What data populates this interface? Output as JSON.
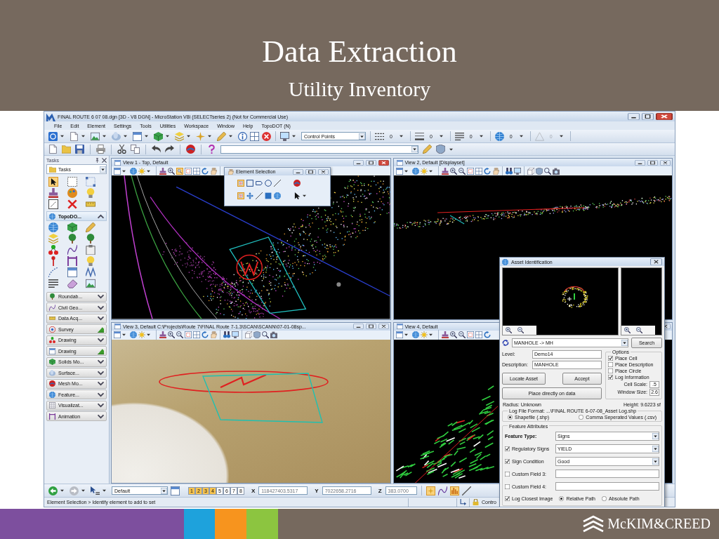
{
  "slide": {
    "title": "Data Extraction",
    "subtitle": "Utility Inventory",
    "logo": "McKIM&CREED"
  },
  "window": {
    "title": "FINAL ROUTE 6 07 08.dgn [3D - V8 DGN] - MicroStation V8i (SELECTseries 2) (Not for Commercial Use)",
    "menu": [
      "File",
      "Edit",
      "Element",
      "Settings",
      "Tools",
      "Utilities",
      "Workspace",
      "Window",
      "Help",
      "TopoDOT (N)"
    ]
  },
  "toolbar": {
    "dropdown": "Control Points",
    "counters": [
      {
        "value": "0",
        "disabled": false
      },
      {
        "value": "0",
        "disabled": false
      },
      {
        "value": "0",
        "disabled": false
      },
      {
        "value": "0",
        "disabled": false
      },
      {
        "value": "0",
        "disabled": true
      }
    ]
  },
  "tasks": {
    "title": "Tasks",
    "dropdown": "Tasks",
    "tools": [
      {
        "selected": true
      },
      {
        "selected": false
      },
      {
        "selected": false
      },
      {
        "selected": false
      },
      {
        "selected": false
      },
      {
        "selected": false
      },
      {
        "selected": false
      },
      {
        "selected": false
      },
      {
        "selected": false
      }
    ],
    "section": "TopoDO...",
    "groups": [
      {
        "label": "Roundab...",
        "kind": "collapsed"
      },
      {
        "label": "Civil Geo...",
        "kind": "collapsed"
      },
      {
        "label": "Data Acq...",
        "kind": "collapsed"
      },
      {
        "label": "Survey",
        "kind": "toolbox"
      },
      {
        "label": "Drawing",
        "kind": "collapsed"
      },
      {
        "label": "Drawing",
        "kind": "toolbox"
      },
      {
        "label": "Solids Mo...",
        "kind": "collapsed"
      },
      {
        "label": "Surface...",
        "kind": "collapsed"
      },
      {
        "label": "Mesh Mo...",
        "kind": "collapsed"
      },
      {
        "label": "Feature...",
        "kind": "collapsed"
      },
      {
        "label": "Visualizat...",
        "kind": "collapsed"
      },
      {
        "label": "Animation",
        "kind": "collapsed"
      }
    ]
  },
  "views": [
    {
      "title": "View 1 - Top, Default",
      "kind": "top",
      "active": true,
      "tools": [
        {
          "selected": false
        },
        {
          "selected": false
        },
        {
          "selected": false
        },
        {
          "selected": false
        },
        {
          "selected": false
        },
        {
          "selected": true
        },
        {
          "selected": false
        },
        {
          "selected": false
        },
        {
          "selected": false
        },
        {
          "selected": false
        }
      ]
    },
    {
      "title": "View 2, Default [Displayset]",
      "kind": "side",
      "active": false,
      "tools": [
        {
          "selected": false
        },
        {
          "selected": false
        },
        {
          "selected": false
        },
        {
          "selected": false
        },
        {
          "selected": false
        },
        {
          "selected": false
        },
        {
          "selected": false
        },
        {
          "selected": false
        },
        {
          "selected": false
        },
        {
          "selected": false
        },
        {
          "selected": false
        },
        {
          "selected": false
        },
        {
          "selected": false
        },
        {
          "selected": false
        },
        {
          "selected": false
        },
        {
          "selected": false
        }
      ]
    },
    {
      "title": "View 3, Default C:\\Projects\\Route 7\\FINAL Route 7-1.3\\SCAN\\SCANN\\07-01-08sp...",
      "kind": "photo",
      "active": false,
      "tools": [
        {
          "selected": false
        },
        {
          "selected": false
        },
        {
          "selected": false
        },
        {
          "selected": false
        },
        {
          "selected": false
        },
        {
          "selected": false
        },
        {
          "selected": false
        },
        {
          "selected": false
        },
        {
          "selected": false
        },
        {
          "selected": false
        },
        {
          "selected": false
        },
        {
          "selected": false
        },
        {
          "selected": false
        },
        {
          "selected": false
        },
        {
          "selected": false
        },
        {
          "selected": false
        }
      ]
    },
    {
      "title": "View 4, Default",
      "kind": "iso",
      "active": false,
      "tools": [
        {
          "selected": false
        },
        {
          "selected": false
        },
        {
          "selected": false
        },
        {
          "selected": false
        },
        {
          "selected": false
        },
        {
          "selected": false
        },
        {
          "selected": false
        },
        {
          "selected": false
        },
        {
          "selected": false
        }
      ]
    }
  ],
  "element_selection": {
    "title": "Element Selection",
    "tools": [
      {
        "selected": true
      },
      {
        "selected": false
      },
      {
        "selected": false
      },
      {
        "selected": false
      },
      {
        "selected": false
      },
      {
        "selected": false
      },
      {
        "selected": true
      },
      {
        "selected": false
      },
      {
        "selected": false
      },
      {
        "selected": false
      },
      {
        "selected": false
      },
      {
        "selected": false
      }
    ]
  },
  "bottom_toolbar": {
    "level": "Default",
    "view_buttons": [
      {
        "label": "1",
        "on": true
      },
      {
        "label": "2",
        "on": true
      },
      {
        "label": "3",
        "on": true
      },
      {
        "label": "4",
        "on": true
      },
      {
        "label": "5",
        "on": false
      },
      {
        "label": "6",
        "on": false
      },
      {
        "label": "7",
        "on": false
      },
      {
        "label": "8",
        "on": false
      }
    ],
    "coordinates": [
      {
        "axis": "X",
        "value": "118427403.5317"
      },
      {
        "axis": "Y",
        "value": "7022658.2716"
      },
      {
        "axis": "Z",
        "value": "383.0700"
      }
    ],
    "toggles": [
      {
        "on": true
      },
      {
        "on": false
      },
      {
        "on": true
      },
      {
        "on": false
      }
    ]
  },
  "status_bar": {
    "prompt": "Element Selection > Identify element to add to set",
    "control": "Contro"
  },
  "asset_dialog": {
    "title": "Asset Identification",
    "asset": "MANHOLE -> MH",
    "search": "Search",
    "level_label": "Level:",
    "level": "Demo14",
    "description_label": "Description:",
    "description": "MANHOLE",
    "locate": "Locate Asset",
    "accept": "Accept",
    "place": "Place directly on data",
    "options_title": "Options",
    "options": [
      {
        "label": "Place Cell",
        "checked": true
      },
      {
        "label": "Place Description",
        "checked": false
      },
      {
        "label": "Place Circle",
        "checked": false
      },
      {
        "label": "Log Information",
        "checked": true
      }
    ],
    "cell_scale_label": "Cell Scale:",
    "cell_scale": ".5",
    "window_size_label": "Window Size:",
    "window_size": "2.6",
    "radius": "Radius: Unknown",
    "height": "Height: 9.6223 sf",
    "log_file": "Log File Format: ...\\FINAL ROUTE 6-07-08_Asset Log.shp",
    "log_formats": [
      {
        "label": "Shapefile (.shp)",
        "selected": true
      },
      {
        "label": "Comma Seperated Values (.csv)",
        "selected": false
      }
    ],
    "attributes_title": "Feature Attributes",
    "attributes": [
      {
        "kind": "dropdown",
        "label": "Feature Type:",
        "value": "Signs"
      },
      {
        "kind": "check_dropdown",
        "label": "Regulatory Signs",
        "checked": true,
        "value": "YIELD"
      },
      {
        "kind": "check_dropdown",
        "label": "Sign Condition",
        "checked": true,
        "value": "Good"
      },
      {
        "kind": "check_field",
        "label": "Custom Field 3:",
        "checked": false
      },
      {
        "kind": "check_field",
        "label": "Custom Field 4:",
        "checked": false
      }
    ],
    "log_image": {
      "label": "Log Closest Image",
      "checked": true
    },
    "path_modes": [
      {
        "label": "Relative Path",
        "selected": true
      },
      {
        "label": "Absolute Path",
        "selected": false
      }
    ]
  }
}
